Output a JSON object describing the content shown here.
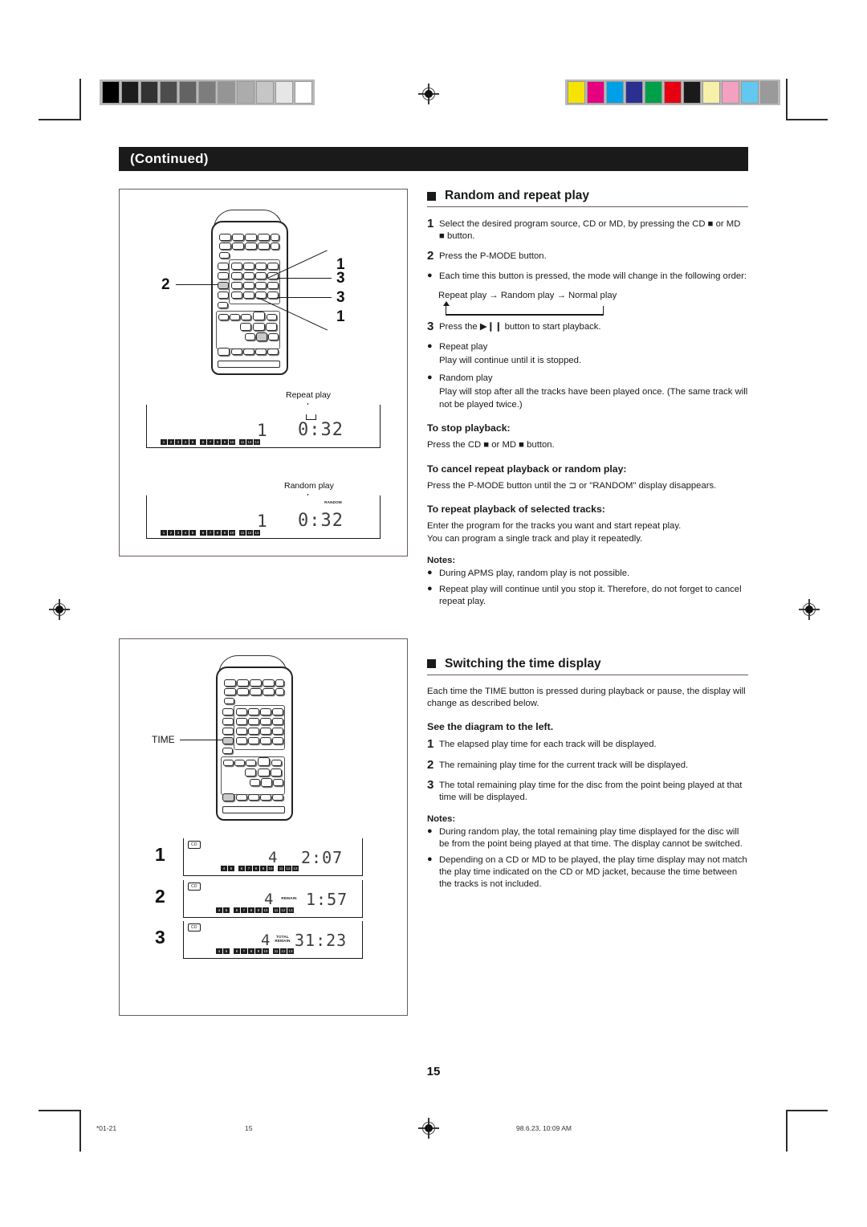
{
  "header": {
    "continued_label": "(Continued)"
  },
  "page_number": "15",
  "footer": {
    "left_code": "*01-21",
    "page_ref": "15",
    "timestamp": "98.6.23, 10:09 AM"
  },
  "calibration": {
    "gray_steps": [
      "#000000",
      "#1c1c1c",
      "#333333",
      "#4d4d4d",
      "#636363",
      "#7d7d7d",
      "#959595",
      "#acacac",
      "#c6c6c6",
      "#e6e6e6",
      "#ffffff"
    ],
    "color_steps": [
      "#f5e400",
      "#e5007f",
      "#00a0e9",
      "#2b2f8f",
      "#00a04a",
      "#e60012",
      "#1a1a1a",
      "#f7f0a8",
      "#f4a0c0",
      "#62c8f0",
      "#9a9a9a"
    ]
  },
  "section1": {
    "heading": "Random and repeat play",
    "steps": [
      {
        "num": "1",
        "text": "Select the desired program source, CD or  MD, by pressing the CD ■ or MD ■ button."
      },
      {
        "num": "2",
        "text": "Press the P-MODE button."
      },
      {
        "num": "●",
        "text": "Each time this button is pressed, the mode will change in the following order:"
      }
    ],
    "cycle_text": "Repeat play → Random play → Normal play",
    "step3": {
      "num": "3",
      "text": "Press the ▶❙❙ button to start playback."
    },
    "bullets": [
      {
        "label": "Repeat play",
        "body": "Play will continue until it is stopped."
      },
      {
        "label": "Random play",
        "body": "Play will stop after all the tracks have been played once. (The same track will not be played twice.)"
      }
    ],
    "stop_heading": "To stop playback:",
    "stop_body": "Press the CD ■ or MD ■ button.",
    "cancel_heading": "To cancel repeat playback or random play:",
    "cancel_body": "Press the P-MODE button until the ⊐ or \"RANDOM\" display disappears.",
    "selected_heading": "To repeat playback of selected tracks:",
    "selected_body1": "Enter the program for the tracks you want and start repeat play.",
    "selected_body2": "You can program a single track and play it repeatedly.",
    "notes_heading": "Notes:",
    "notes": [
      "During APMS play, random play is not possible.",
      "Repeat play will continue until you stop it. Therefore, do not forget to cancel repeat play."
    ]
  },
  "section2": {
    "heading": "Switching the time display",
    "intro": "Each time the TIME button is pressed during playback or pause, the display will change as described below.",
    "see_diagram": "See the diagram to the left.",
    "steps": [
      {
        "num": "1",
        "text": "The elapsed play time for each track will be displayed."
      },
      {
        "num": "2",
        "text": "The remaining play time for the current track will be displayed."
      },
      {
        "num": "3",
        "text": "The total remaining play time for the disc from the point being played at that time will be displayed."
      }
    ],
    "notes_heading": "Notes:",
    "notes": [
      "During random play, the total remaining play time displayed for the disc will be from the point being played at that time. The display cannot be switched.",
      "Depending on a CD or MD to be played, the play time display may not match the play time indicated on the CD or MD jacket, because the time between the tracks is not included."
    ]
  },
  "figure1": {
    "callouts": [
      "1",
      "3",
      "3",
      "1",
      "2"
    ],
    "displays": [
      {
        "caption": "Repeat play",
        "indicator": "repeat-symbol",
        "track": "1",
        "time": "0:32",
        "track_numbers": [
          "1",
          "2",
          "3",
          "4",
          "5",
          "6",
          "7",
          "8",
          "9",
          "10",
          "11",
          "12",
          "13"
        ]
      },
      {
        "caption": "Random play",
        "indicator": "RANDOM",
        "track": "1",
        "time": "0:32",
        "track_numbers": [
          "1",
          "2",
          "3",
          "4",
          "5",
          "6",
          "7",
          "8",
          "9",
          "10",
          "11",
          "12",
          "13"
        ]
      }
    ]
  },
  "figure2": {
    "button_label": "TIME",
    "displays": [
      {
        "num": "1",
        "source": "CD",
        "track": "4",
        "mode": "",
        "time": "2:07",
        "track_numbers": [
          "4",
          "5",
          "6",
          "7",
          "8",
          "9",
          "10",
          "11",
          "12",
          "13"
        ]
      },
      {
        "num": "2",
        "source": "CD",
        "track": "4",
        "mode": "REMAIN",
        "time": "1:57",
        "track_numbers": [
          "4",
          "5",
          "6",
          "7",
          "8",
          "9",
          "10",
          "11",
          "12",
          "13"
        ]
      },
      {
        "num": "3",
        "source": "CD",
        "track": "4",
        "mode": "TOTAL REMAIN",
        "time": "31:23",
        "track_numbers": [
          "4",
          "5",
          "6",
          "7",
          "8",
          "9",
          "10",
          "11",
          "12",
          "13"
        ]
      }
    ]
  }
}
